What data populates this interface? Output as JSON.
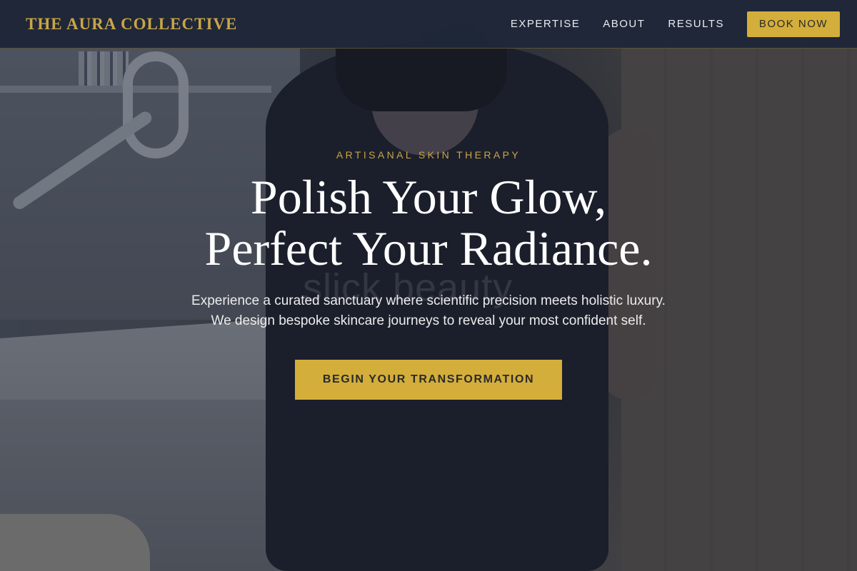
{
  "brand": {
    "name": "THE AURA COLLECTIVE",
    "accent_color": "#d4ae3a"
  },
  "nav": {
    "items": [
      {
        "label": "EXPERTISE"
      },
      {
        "label": "ABOUT"
      },
      {
        "label": "RESULTS"
      }
    ],
    "book_label": "BOOK NOW"
  },
  "hero": {
    "eyebrow": "ARTISANAL SKIN THERAPY",
    "headline_line1": "Polish Your Glow,",
    "headline_line2": "Perfect Your Radiance.",
    "subtitle": "Experience a curated sanctuary where scientific precision meets holistic luxury. We design bespoke skincare journeys to reveal your most confident self.",
    "cta_label": "BEGIN YOUR TRANSFORMATION",
    "background_watermark": "slick beauty"
  }
}
